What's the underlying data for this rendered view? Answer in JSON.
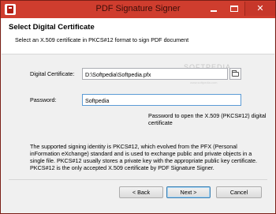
{
  "window": {
    "title": "PDF Signature Signer"
  },
  "header": {
    "title": "Select Digital Certificate",
    "subtitle": "Select an X.509 certificate in PKCS#12 format to sign PDF document"
  },
  "form": {
    "certificate_label": "Digital Certificate:",
    "certificate_value": "D:\\Softpedia\\Softpedia.pfx",
    "password_label": "Password:",
    "password_value": "Softpedia",
    "password_help": "Password to open the X.509 (PKCS#12) digital certificate"
  },
  "info_text": "The supported signing identity is PKCS#12, which evolved from the PFX (Personal inFormation eXchange) standard and is used to exchange public and private objects in a single file. PKCS#12 usually stores a private key with the appropriate public key certificate. PKCS#12 is the only accepted X.509 certificate by PDF Signature Signer.",
  "watermark": {
    "text": "SOFTPEDIA",
    "sub": "www.softpedia.com"
  },
  "buttons": {
    "back": "< Back",
    "next": "Next >",
    "cancel": "Cancel"
  },
  "colors": {
    "titlebar": "#cf3d2e",
    "close": "#c7372a"
  },
  "icons": {
    "app": "pdf-app-icon",
    "browse": "folder-icon"
  }
}
